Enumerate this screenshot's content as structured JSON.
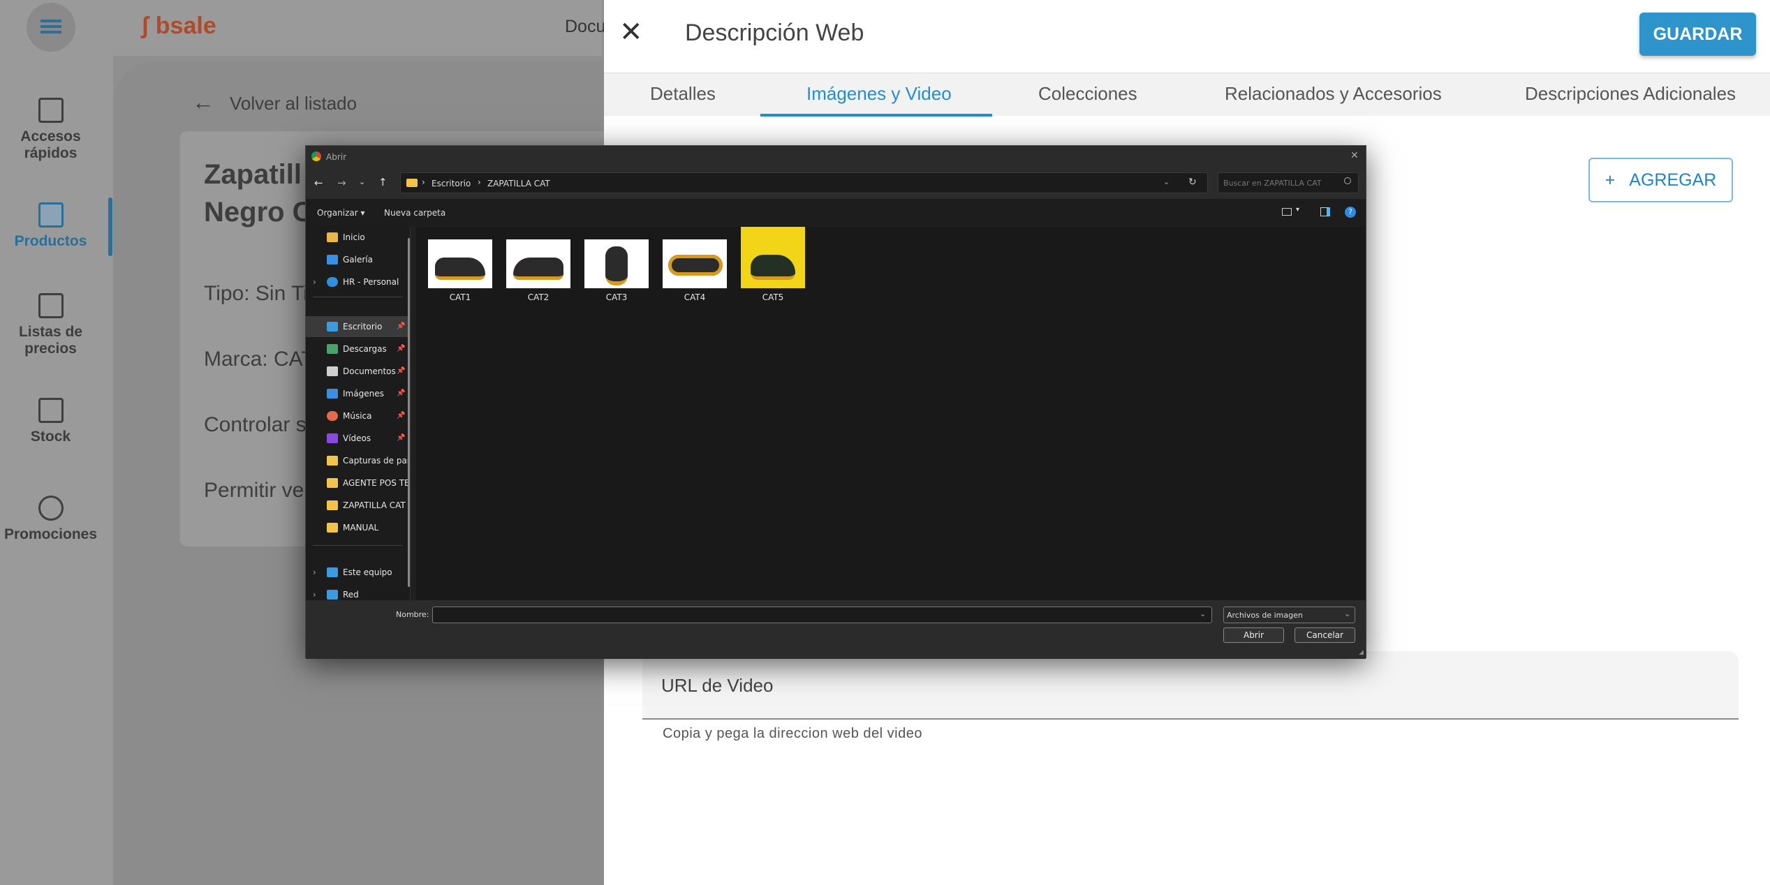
{
  "app": {
    "brand": "bsale",
    "topbar_text": "Docu",
    "nav": [
      {
        "label": "Accesos rápidos",
        "icon": "dashboard-icon"
      },
      {
        "label": "Productos",
        "icon": "products-icon",
        "active": true
      },
      {
        "label": "Listas de precios",
        "icon": "price-list-icon"
      },
      {
        "label": "Stock",
        "icon": "box-icon"
      },
      {
        "label": "Promociones",
        "icon": "discount-icon"
      }
    ],
    "back_label": "Volver al listado",
    "product_title": "Zapatill Negro C",
    "product_title_line1": "Zapatill",
    "product_title_line2": "Negro C",
    "fields": [
      "Tipo: Sin Ti",
      "Marca: CAT",
      "Controlar s",
      "Permitir ve"
    ]
  },
  "panel": {
    "title": "Descripción Web",
    "save_label": "GUARDAR",
    "tabs": [
      "Detalles",
      "Imágenes y Video",
      "Colecciones",
      "Relacionados y Accesorios",
      "Descripciones Adicionales"
    ],
    "active_tab": "Imágenes y Video",
    "add_label": "AGREGAR",
    "add_plus": "+",
    "video_label": "URL de Video",
    "video_help": "Copia y pega la direccion web del video"
  },
  "dialog": {
    "title": "Abrir",
    "path": [
      "Escritorio",
      "ZAPATILLA CAT"
    ],
    "search_placeholder": "Buscar en ZAPATILLA CAT",
    "organize_label": "Organizar",
    "new_folder_label": "Nueva carpeta",
    "nav_items": [
      {
        "label": "Inicio",
        "icon": "home-icon"
      },
      {
        "label": "Galería",
        "icon": "gallery-icon"
      },
      {
        "label": "HR - Personal",
        "icon": "cloud-icon"
      },
      {
        "label": "Escritorio",
        "icon": "desktop-icon",
        "pinned": true,
        "selected": true
      },
      {
        "label": "Descargas",
        "icon": "download-icon",
        "pinned": true
      },
      {
        "label": "Documentos",
        "icon": "document-icon",
        "pinned": true
      },
      {
        "label": "Imágenes",
        "icon": "pictures-icon",
        "pinned": true
      },
      {
        "label": "Música",
        "icon": "music-icon",
        "pinned": true
      },
      {
        "label": "Vídeos",
        "icon": "video-icon",
        "pinned": true
      },
      {
        "label": "Capturas de par",
        "icon": "folder-icon"
      },
      {
        "label": "AGENTE POS TE",
        "icon": "folder-icon"
      },
      {
        "label": "ZAPATILLA CAT",
        "icon": "folder-icon"
      },
      {
        "label": "MANUAL",
        "icon": "folder-icon"
      },
      {
        "label": "Este equipo",
        "icon": "computer-icon"
      },
      {
        "label": "Red",
        "icon": "network-icon"
      }
    ],
    "files": [
      {
        "name": "CAT1"
      },
      {
        "name": "CAT2"
      },
      {
        "name": "CAT3"
      },
      {
        "name": "CAT4"
      },
      {
        "name": "CAT5"
      }
    ],
    "filename_label": "Nombre:",
    "filename_value": "",
    "filter_label": "Archivos de imagen",
    "open_label": "Abrir",
    "cancel_label": "Cancelar"
  },
  "colors": {
    "accent": "#2f93cc",
    "dialog_bg": "#202020",
    "overlay": "#8f8f8f",
    "folder": "#f3c44c"
  }
}
